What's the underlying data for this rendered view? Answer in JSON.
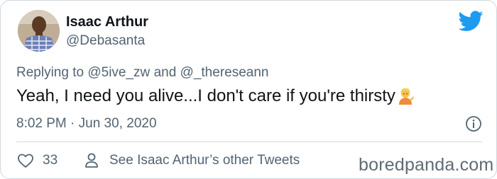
{
  "author": {
    "name": "Isaac Arthur",
    "handle": "@Debasanta"
  },
  "reply": {
    "prefix": "Replying to",
    "mention1": "@5ive_zw",
    "conjunction": "and",
    "mention2": "@_thereseann"
  },
  "tweet": {
    "text": "Yeah, I need you alive...I don't care if you're thirsty",
    "emoji": "person-tipping-hand",
    "timestamp": "8:02 PM · Jun 30, 2020"
  },
  "actions": {
    "like_count": "33",
    "profile_link": "See Isaac Arthur’s other Tweets"
  },
  "watermark": "boredpanda.com",
  "colors": {
    "text": "#0f1419",
    "muted": "#536471",
    "twitter_blue": "#1d9bf0",
    "border": "#cfd9de"
  }
}
